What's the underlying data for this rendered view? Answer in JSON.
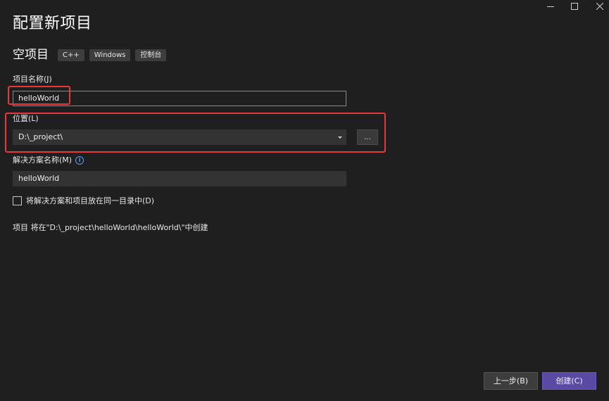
{
  "window": {
    "controls": {
      "minimize_icon": "minimize-icon",
      "maximize_icon": "maximize-icon",
      "close_icon": "close-icon"
    }
  },
  "header": {
    "title": "配置新项目",
    "project_type": "空项目",
    "tags": [
      "C++",
      "Windows",
      "控制台"
    ]
  },
  "form": {
    "project_name_label": "项目名称(J)",
    "project_name_value": "helloWorld",
    "location_label": "位置(L)",
    "location_value": "D:\\_project\\",
    "browse_label": "...",
    "solution_name_label": "解决方案名称(M)",
    "solution_info_icon": "info-icon",
    "solution_name_value": "helloWorld",
    "same_dir_label": "将解决方案和项目放在同一目录中(D)",
    "same_dir_checked": false,
    "path_note": "项目 将在\"D:\\_project\\helloWorld\\helloWorld\\\"中创建"
  },
  "footer": {
    "back_label": "上一步(B)",
    "create_label": "创建(C)"
  },
  "colors": {
    "background": "#1f1f1f",
    "field": "#333333",
    "accent": "#5b4aa3",
    "highlight": "#e8383d",
    "info": "#5aa0ff"
  }
}
